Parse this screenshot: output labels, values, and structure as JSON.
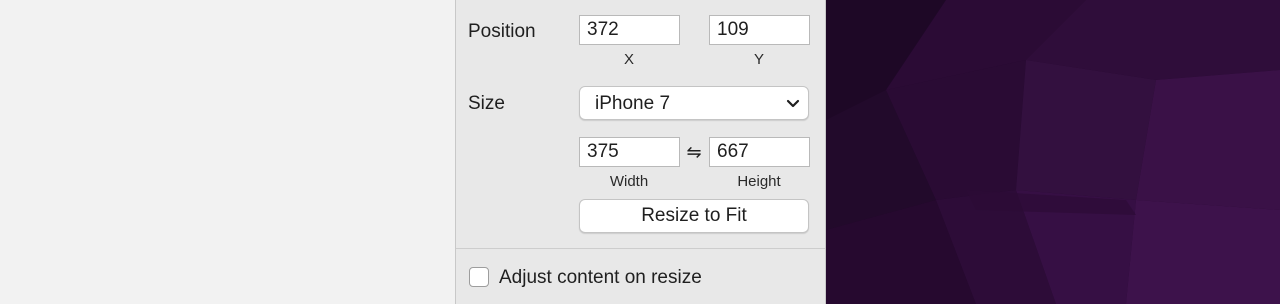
{
  "inspector": {
    "position": {
      "label": "Position",
      "x_value": "372",
      "y_value": "109",
      "x_caption": "X",
      "y_caption": "Y"
    },
    "size": {
      "label": "Size",
      "preset_selected": "iPhone 7",
      "width_value": "375",
      "height_value": "667",
      "width_caption": "Width",
      "height_caption": "Height",
      "lock_glyph": "⇋"
    },
    "resize_button_label": "Resize to Fit",
    "adjust_content": {
      "label": "Adjust content on resize",
      "checked": false
    }
  },
  "colors": {
    "panel_bg": "#e8e8e8",
    "left_bg": "#f2f2f2",
    "desktop_dark": "#2a0a33",
    "desktop_mid": "#3a0f48"
  }
}
